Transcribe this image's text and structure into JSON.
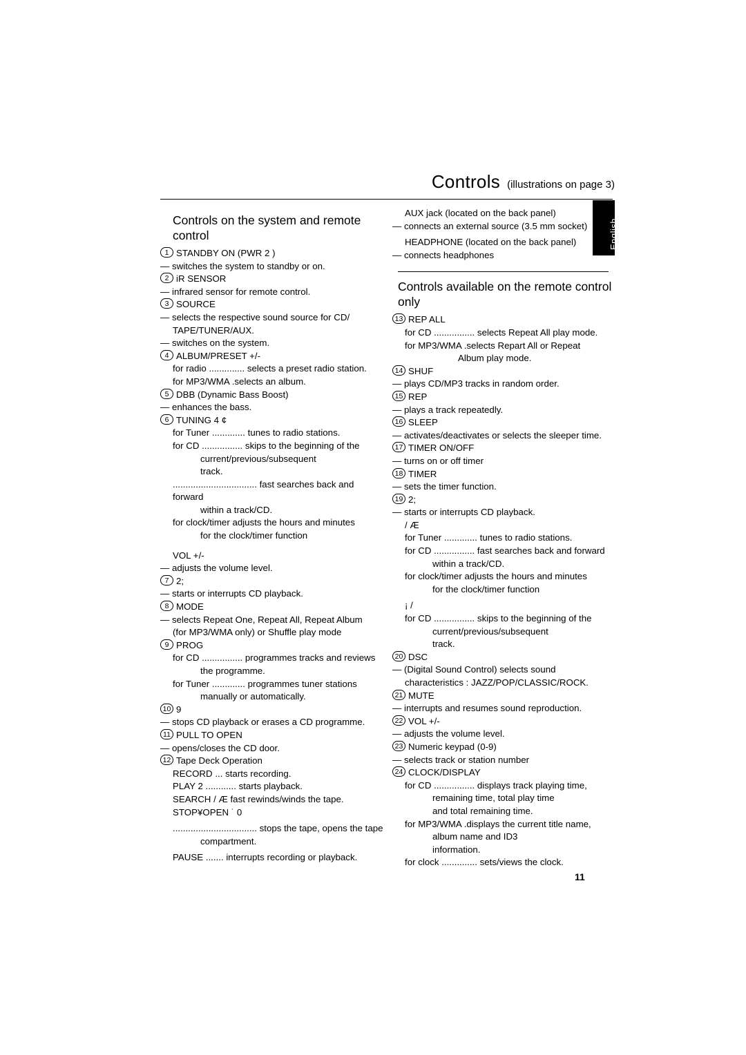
{
  "header": {
    "title": "Controls",
    "subtitle": "(illustrations on page 3)"
  },
  "side_tab": {
    "label": "English"
  },
  "page_number": "11",
  "left_column": {
    "section_heading": "Controls on the system and remote control",
    "entries": [
      {
        "num": "1",
        "label": "STANDBY ON (PWR  2 )",
        "lines": [
          "— switches the system to standby or on."
        ]
      },
      {
        "num": "2",
        "label": "iR SENSOR",
        "lines": [
          "— infrared sensor for remote control."
        ]
      },
      {
        "num": "3",
        "label": "SOURCE",
        "lines": [
          "— selects the respective sound source for CD/",
          "TAPE/TUNER/AUX.",
          "— switches on the system."
        ]
      },
      {
        "num": "4",
        "label": "ALBUM/PRESET +/-",
        "lines": [
          "for radio .............. selects a preset radio station.",
          "for MP3/WMA .selects an album."
        ]
      },
      {
        "num": "5",
        "label": "DBB            (Dynamic Bass Boost)",
        "lines": [
          "— enhances the bass."
        ]
      },
      {
        "num": "6",
        "label": "TUNING  4 ¢",
        "lines": [
          "for Tuner ............. tunes to radio stations.",
          "for CD ................ skips to the beginning of the",
          "current/previous/subsequent",
          "track.",
          "................................. fast searches back and forward",
          "within a track/CD.",
          "for clock/timer  adjusts the hours and minutes",
          "for the clock/timer function"
        ]
      },
      {
        "num": "",
        "label": "VOL +/-",
        "lines": [
          "— adjusts the volume level."
        ]
      },
      {
        "num": "7",
        "label": "2;",
        "lines": [
          "— starts or interrupts CD playback."
        ]
      },
      {
        "num": "8",
        "label": "MODE",
        "lines": [
          "— selects Repeat One, Repeat All, Repeat Album",
          "(for MP3/WMA only) or Shuffle play mode"
        ]
      },
      {
        "num": "9",
        "label": "PROG",
        "lines": [
          "for CD ................ programmes tracks and reviews",
          "the programme.",
          "for Tuner ............. programmes tuner stations",
          "manually or automatically."
        ]
      },
      {
        "num": "10",
        "label": "9",
        "lines": [
          "— stops CD playback or erases a CD programme."
        ]
      },
      {
        "num": "11",
        "label": "PULL TO OPEN",
        "lines": [
          "— opens/closes the CD door."
        ]
      },
      {
        "num": "12",
        "label": "Tape Deck Operation",
        "lines": [
          "RECORD     ... starts recording.",
          "PLAY  2 ............ starts playback.",
          "SEARCH      / Æ  fast rewinds/winds the tape.",
          "STOP¥OPEN ˙  0",
          "................................. stops the tape, opens the tape",
          "compartment.",
          "PAUSE ....... interrupts recording or playback."
        ]
      }
    ]
  },
  "right_column": {
    "top_entries": [
      {
        "label": "AUX jack (located on the back panel)",
        "lines": [
          "— connects an external source (3.5 mm socket)"
        ]
      },
      {
        "label": "HEADPHONE (located on the back panel)",
        "lines": [
          "— connects headphones"
        ]
      }
    ],
    "section_heading": "Controls available on the remote control only",
    "entries": [
      {
        "num": "13",
        "label": "REP ALL",
        "lines": [
          "for CD ................ selects Repeat All play mode.",
          "for MP3/WMA .selects Repart All or Repeat",
          "Album play mode."
        ]
      },
      {
        "num": "14",
        "label": "SHUF",
        "lines": [
          "— plays CD/MP3 tracks in random order."
        ]
      },
      {
        "num": "15",
        "label": "REP",
        "lines": [
          "— plays a track repeatedly."
        ]
      },
      {
        "num": "16",
        "label": "SLEEP",
        "lines": [
          "— activates/deactivates or selects the sleeper time."
        ]
      },
      {
        "num": "17",
        "label": "TIMER ON/OFF",
        "lines": [
          "— turns on or off timer"
        ]
      },
      {
        "num": "18",
        "label": "TIMER",
        "lines": [
          "— sets the timer function."
        ]
      },
      {
        "num": "19",
        "label": "2;",
        "lines": [
          "— starts or interrupts CD playback."
        ]
      },
      {
        "num": "",
        "label": "   / Æ",
        "lines": [
          "for Tuner ............. tunes to radio stations.",
          "for CD ................ fast searches back and forward",
          "within a track/CD.",
          "for clock/timer  adjusts the hours and minutes",
          "for the clock/timer function"
        ]
      },
      {
        "num": "",
        "label": "¡ /",
        "lines": [
          "for CD ................ skips to the beginning of the",
          "current/previous/subsequent",
          "track."
        ]
      },
      {
        "num": "20",
        "label": "DSC",
        "lines": [
          "— (Digital Sound Control) selects sound",
          "characteristics : JAZZ/POP/CLASSIC/ROCK."
        ]
      },
      {
        "num": "21",
        "label": "MUTE",
        "lines": [
          "— interrupts and resumes sound reproduction."
        ]
      },
      {
        "num": "22",
        "label": "VOL +/-",
        "lines": [
          "— adjusts the volume level."
        ]
      },
      {
        "num": "23",
        "label": "Numeric keypad (0-9)",
        "lines": [
          "— selects track or station number"
        ]
      },
      {
        "num": "24",
        "label": "CLOCK/DISPLAY",
        "lines": [
          "for CD ................ displays track playing time,",
          "remaining time, total play time",
          "and total remaining time.",
          "for MP3/WMA .displays the current title name,",
          "album name and ID3",
          "information.",
          "for clock .............. sets/views the clock."
        ]
      }
    ]
  }
}
